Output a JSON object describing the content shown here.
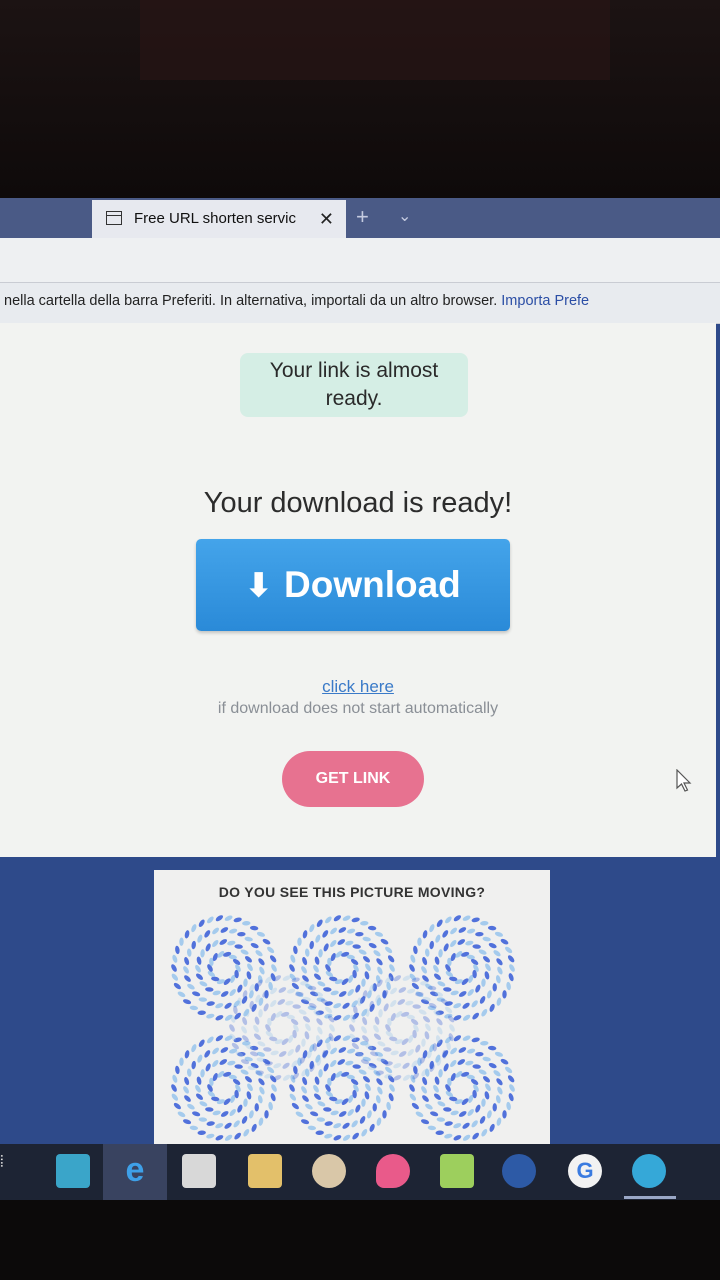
{
  "browser": {
    "tab_title": "Free URL shorten servic",
    "tab_close": "✕",
    "new_tab": "+",
    "tab_menu": "⌄"
  },
  "favorites_bar": {
    "text": "nella cartella della barra Preferiti. In alternativa, importali da un altro browser.",
    "link": "Importa Prefe"
  },
  "page": {
    "almost_ready": "Your link is almost ready.",
    "ready_title": "Your download is ready!",
    "download_label": "Download",
    "download_icon": "⬇",
    "click_here": "click here",
    "note": "if download does not start automatically",
    "get_link": "GET LINK"
  },
  "ad": {
    "title": "DO YOU SEE THIS PICTURE MOVING?"
  },
  "colors": {
    "download_button": "#2f90dc",
    "get_link_button": "#e77290",
    "almost_ready_bg": "#d5eee5"
  }
}
